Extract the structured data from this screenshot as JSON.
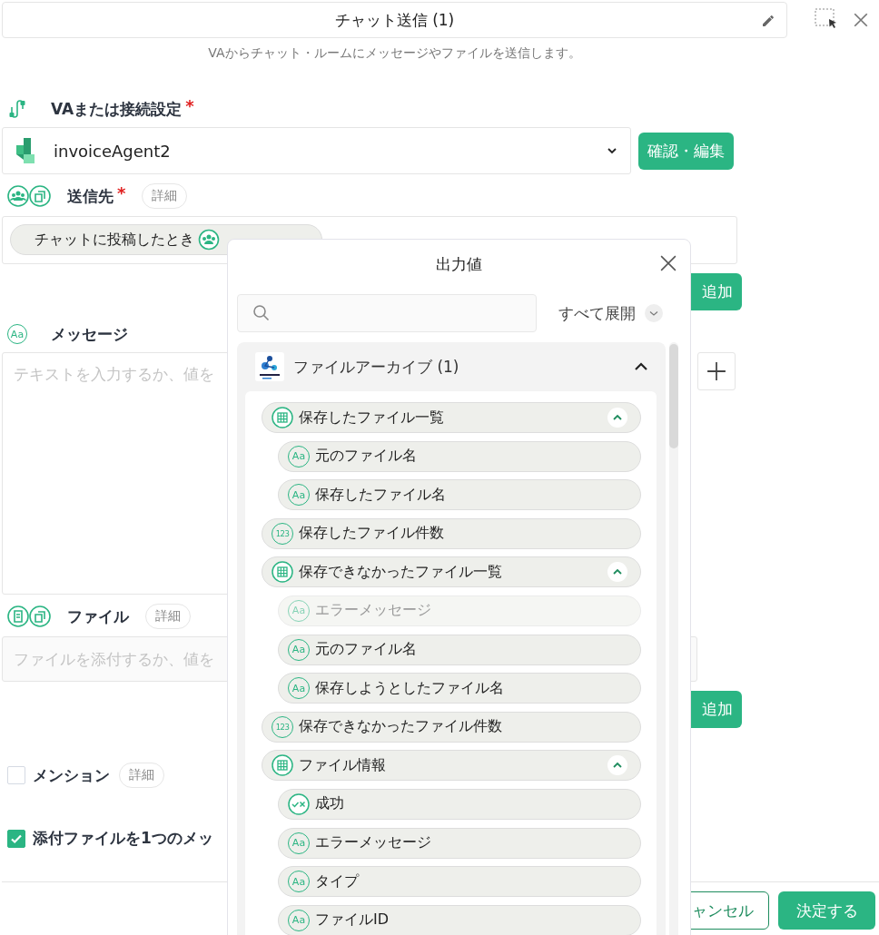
{
  "header": {
    "title": "チャット送信 (1)",
    "description": "VAからチャット・ルームにメッセージやファイルを送信します。"
  },
  "connection": {
    "label": "VAまたは接続設定",
    "required": "*",
    "value": "invoiceAgent2",
    "button": "確認・編集"
  },
  "recipient": {
    "label": "送信先",
    "required": "*",
    "detail": "詳細",
    "chip": "チャットに投稿したとき",
    "add_button": "追加"
  },
  "message": {
    "label": "メッセージ",
    "icon": "Aa",
    "placeholder": "テキストを入力するか、値を"
  },
  "file": {
    "label": "ファイル",
    "detail": "詳細",
    "placeholder": "ファイルを添付するか、値を",
    "add_button": "追加"
  },
  "options": [
    {
      "label": "メンション",
      "checked": false,
      "detail": "詳細"
    },
    {
      "label": "添付ファイルを1つのメッ",
      "checked": true
    }
  ],
  "footer": {
    "cancel": "ャンセル",
    "submit": "決定する"
  },
  "popover": {
    "title": "出力値",
    "expand_all": "すべて展開",
    "group": {
      "title": "ファイルアーカイブ (1)",
      "expanded": true,
      "items": [
        {
          "label": "保存したファイル一覧",
          "kind": "table",
          "expanded": true,
          "disabled": false,
          "children": [
            {
              "label": "元のファイル名",
              "kind": "text",
              "icon": "Aa",
              "disabled": false
            },
            {
              "label": "保存したファイル名",
              "kind": "text",
              "icon": "Aa",
              "disabled": false
            }
          ]
        },
        {
          "label": "保存したファイル件数",
          "kind": "number",
          "icon": "123",
          "disabled": false
        },
        {
          "label": "保存できなかったファイル一覧",
          "kind": "table",
          "expanded": true,
          "disabled": false,
          "children": [
            {
              "label": "エラーメッセージ",
              "kind": "text",
              "icon": "Aa",
              "disabled": true
            },
            {
              "label": "元のファイル名",
              "kind": "text",
              "icon": "Aa",
              "disabled": false
            },
            {
              "label": "保存しようとしたファイル名",
              "kind": "text",
              "icon": "Aa",
              "disabled": false
            }
          ]
        },
        {
          "label": "保存できなかったファイル件数",
          "kind": "number",
          "icon": "123",
          "disabled": false
        },
        {
          "label": "ファイル情報",
          "kind": "table",
          "expanded": true,
          "disabled": false,
          "children": [
            {
              "label": "成功",
              "kind": "boolean",
              "disabled": false
            },
            {
              "label": "エラーメッセージ",
              "kind": "text",
              "icon": "Aa",
              "disabled": false
            },
            {
              "label": "タイプ",
              "kind": "text",
              "icon": "Aa",
              "disabled": false
            },
            {
              "label": "ファイルID",
              "kind": "text",
              "icon": "Aa",
              "disabled": false
            }
          ]
        }
      ]
    }
  }
}
